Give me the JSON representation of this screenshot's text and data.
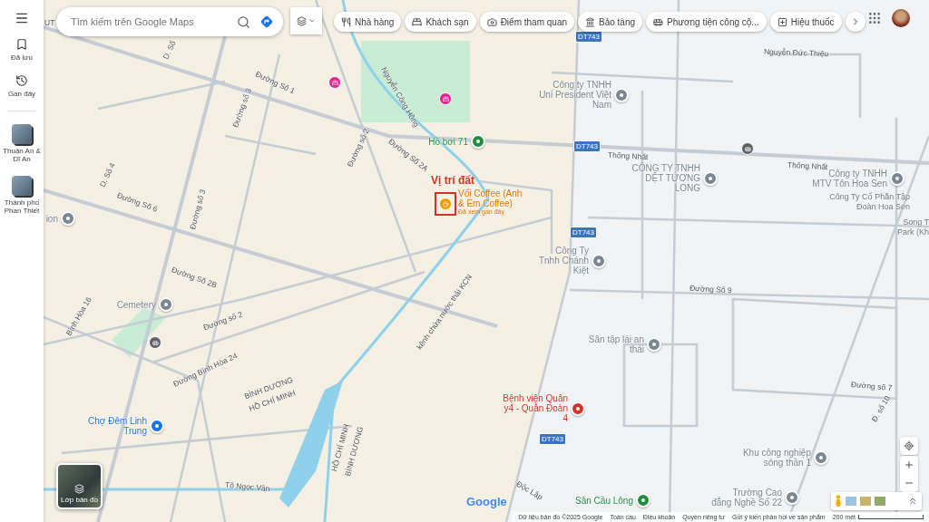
{
  "sidebar": {
    "items": [
      {
        "label": "Đã lưu",
        "kind": "saved"
      },
      {
        "label": "Gần đây",
        "kind": "recent"
      }
    ],
    "recent_places": [
      {
        "label": "Thuận An & Dĩ An"
      },
      {
        "label": "Thành phố Phan Thiết"
      }
    ]
  },
  "search": {
    "placeholder": "Tìm kiếm trên Google Maps"
  },
  "chips": [
    {
      "label": "Nhà hàng",
      "kind": "restaurant"
    },
    {
      "label": "Khách sạn",
      "kind": "hotel"
    },
    {
      "label": "Điểm tham quan",
      "kind": "sights"
    },
    {
      "label": "Bảo tàng",
      "kind": "museum"
    },
    {
      "label": "Phương tiện công cộ...",
      "kind": "transit"
    },
    {
      "label": "Hiệu thuốc",
      "kind": "pharmacy"
    }
  ],
  "map": {
    "places": [
      {
        "name": "ion",
        "color": "#7a8691",
        "pin": true
      },
      {
        "name": "Công ty TNHH Uni President Việt Nam",
        "color": "#7a8691",
        "pin": true
      },
      {
        "name": "Hồ bơi 71",
        "color": "#1e8e3e",
        "pin": true
      },
      {
        "name": "CÔNG TY TNHH DỆT TƯƠNG LONG",
        "color": "#7a8691",
        "pin": true
      },
      {
        "name": "Công ty TNHH MTV Tôn Hoa Sen",
        "color": "#7a8691",
        "pin": true
      },
      {
        "name": "Công Ty Cổ Phần Tập Đoàn Hoa Sen",
        "pin": false
      },
      {
        "name": "Song T Park (Kh",
        "pin": false
      },
      {
        "name": "Công Ty Tnhh Chánh Kiệt",
        "color": "#7a8691",
        "pin": true
      },
      {
        "name": "Cemetery",
        "color": "#7a8691",
        "pin": true
      },
      {
        "name": "Sân tập lái an thái",
        "color": "#7a8691",
        "pin": true
      },
      {
        "name": "Bệnh viện Quân y4 - Quân Đoàn 4",
        "color": "#d93025",
        "pin": true
      },
      {
        "name": "Chợ Đêm Linh Trung",
        "color": "#1a73e8",
        "pin": true
      },
      {
        "name": "Khu công nghiệp sóng thần 1",
        "color": "#7a8691",
        "pin": true
      },
      {
        "name": "Sân Cầu Lông",
        "color": "#1e8e3e",
        "pin": true
      },
      {
        "name": "Trường Cao đẳng Nghề Số 22",
        "color": "#7a8691",
        "pin": true
      }
    ],
    "streets": [
      {
        "name": "UT"
      },
      {
        "name": "D. Số"
      },
      {
        "name": "Đường Số 1"
      },
      {
        "name": "Đường số 3"
      },
      {
        "name": "Nguyễn Công Hồng"
      },
      {
        "name": "Đường số 2"
      },
      {
        "name": "Đường Số 2A"
      },
      {
        "name": "D. Số 4"
      },
      {
        "name": "Đường Số 6"
      },
      {
        "name": "Đường số 3"
      },
      {
        "name": "Nguyễn Đức Thiệu"
      },
      {
        "name": "Thống Nhất"
      },
      {
        "name": "Thống Nhất"
      },
      {
        "name": "Đường Số 2B"
      },
      {
        "name": "Đường Số 9"
      },
      {
        "name": "Bình Hòa 16"
      },
      {
        "name": "Đường số 2"
      },
      {
        "name": "kênh chứa nước thải KCN"
      },
      {
        "name": "Đường Bình Hòa 24"
      },
      {
        "name": "BÌNH DƯƠNG"
      },
      {
        "name": "HỒ CHÍ MINH"
      },
      {
        "name": "HỒ CHÍ MINH"
      },
      {
        "name": "BÌNH DƯƠNG"
      },
      {
        "name": "Đường số 7"
      },
      {
        "name": "Đ. số 10"
      },
      {
        "name": "Tô Ngọc Vân"
      },
      {
        "name": "Độc Lập"
      }
    ],
    "shields": [
      "DT743",
      "DT743",
      "DT743",
      "DT743"
    ],
    "annotation": {
      "label": "Vị trí đất"
    },
    "featured": {
      "name": "Vối Coffee (Anh & Em Coffee)",
      "note": "Đã xem gần đây"
    }
  },
  "layers": {
    "label": "Lớp bản đồ"
  },
  "logo": "Google",
  "footer": {
    "links": [
      "Dữ liệu bản đồ ©2025 Google",
      "Toàn cầu",
      "Điều khoản",
      "Quyền riêng tư",
      "Gửi ý kiến phản hồi về sản phẩm"
    ],
    "scale": "200 mét"
  }
}
